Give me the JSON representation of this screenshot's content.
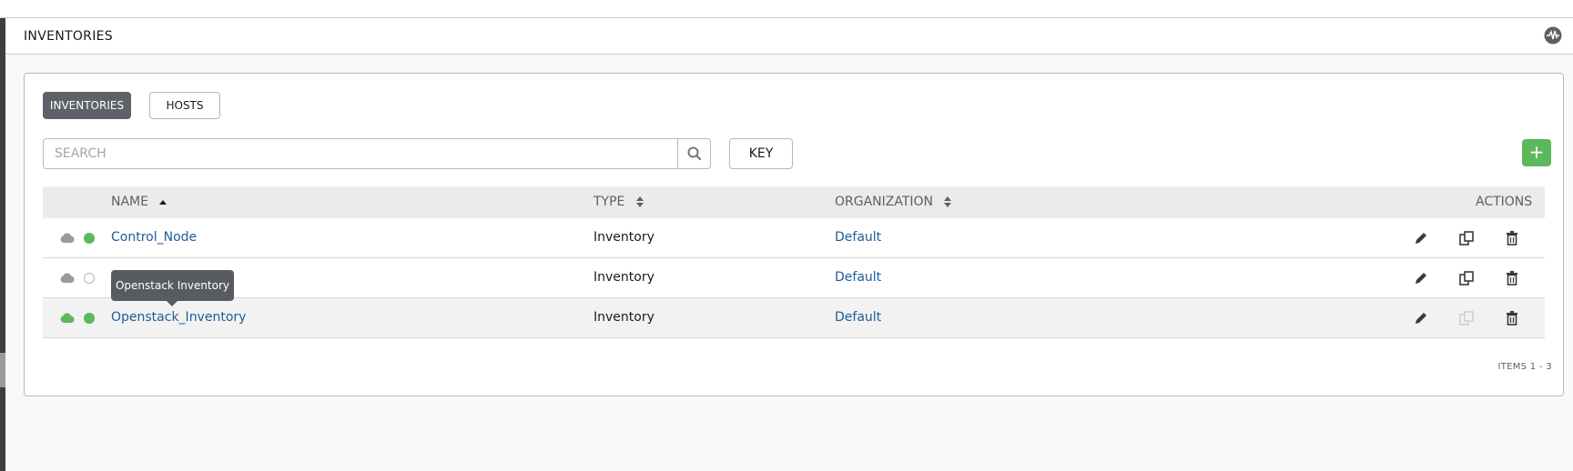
{
  "header": {
    "title": "INVENTORIES"
  },
  "tabs": {
    "inventories": "INVENTORIES",
    "hosts": "HOSTS"
  },
  "search": {
    "placeholder": "SEARCH"
  },
  "key_button": "KEY",
  "add_button": "+",
  "table": {
    "columns": {
      "name": "NAME",
      "type": "TYPE",
      "organization": "ORGANIZATION",
      "actions": "ACTIONS"
    },
    "rows": [
      {
        "name": "Control_Node",
        "type": "Inventory",
        "organization": "Default"
      },
      {
        "name": "",
        "type": "Inventory",
        "organization": "Default"
      },
      {
        "name": "Openstack_Inventory",
        "type": "Inventory",
        "organization": "Default"
      }
    ]
  },
  "tooltip": "Openstack Inventory",
  "pagination": {
    "items": "ITEMS  1 - 3"
  },
  "colors": {
    "accent_green": "#5cb85c",
    "link_blue": "#1f5b99",
    "active_tab": "#5e6268"
  }
}
